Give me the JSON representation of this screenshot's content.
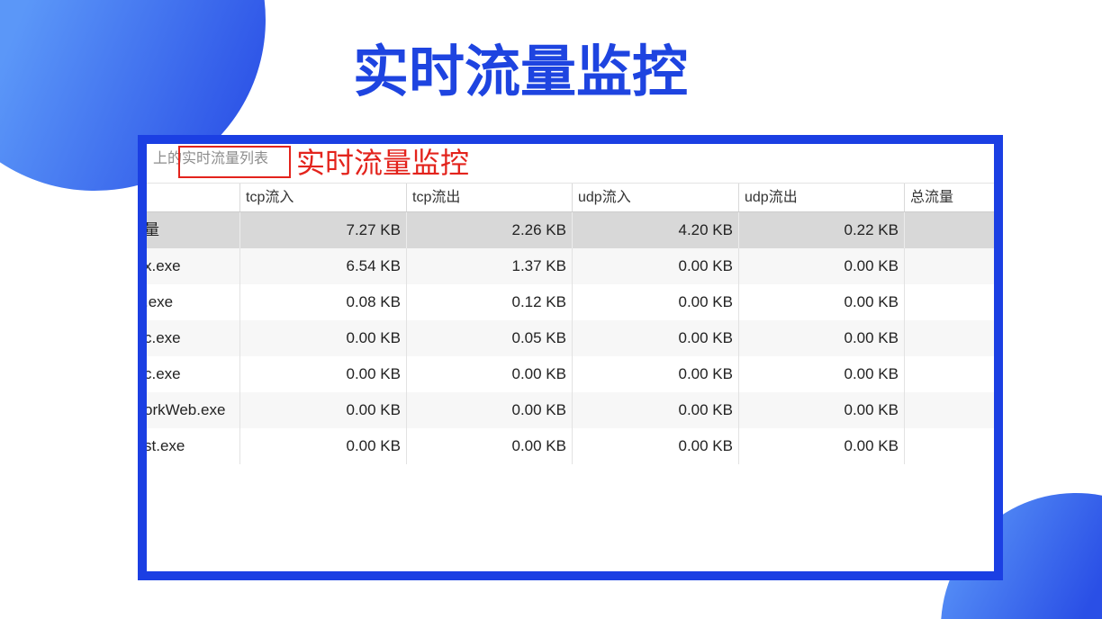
{
  "slide": {
    "title": "实时流量监控"
  },
  "colors": {
    "title": "#1e44e0",
    "frame": "#1b3fe3",
    "red": "#e3231c",
    "sel": "#d8d8d8",
    "alt": "#f7f7f7",
    "circle_light": "#5b97f8",
    "circle_dark": "#2a4fe6"
  },
  "screenshot": {
    "caption": "上的实时流量列表",
    "annotation": "实时流量监控",
    "table": {
      "columns": [
        "tcp流入",
        "tcp流出",
        "udp流入",
        "udp流出",
        "总流量"
      ],
      "rows": [
        {
          "name": "量",
          "values": [
            "7.27 KB",
            "2.26 KB",
            "4.20 KB",
            "0.22 KB"
          ],
          "selected": true
        },
        {
          "name": "x.exe",
          "values": [
            "6.54 KB",
            "1.37 KB",
            "0.00 KB",
            "0.00 KB"
          ]
        },
        {
          "name": ".exe",
          "values": [
            "0.08 KB",
            "0.12 KB",
            "0.00 KB",
            "0.00 KB"
          ]
        },
        {
          "name": "c.exe",
          "values": [
            "0.00 KB",
            "0.05 KB",
            "0.00 KB",
            "0.00 KB"
          ]
        },
        {
          "name": "c.exe",
          "values": [
            "0.00 KB",
            "0.00 KB",
            "0.00 KB",
            "0.00 KB"
          ]
        },
        {
          "name": "orkWeb.exe",
          "values": [
            "0.00 KB",
            "0.00 KB",
            "0.00 KB",
            "0.00 KB"
          ]
        },
        {
          "name": "st.exe",
          "values": [
            "0.00 KB",
            "0.00 KB",
            "0.00 KB",
            "0.00 KB"
          ]
        }
      ]
    }
  }
}
